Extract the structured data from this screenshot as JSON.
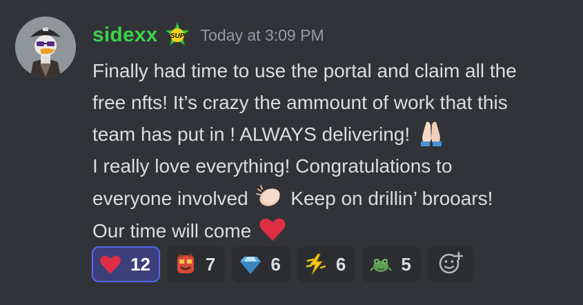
{
  "message": {
    "username": "sidexx",
    "badge_icon": "sup-badge-icon",
    "timestamp": "Today at 3:09 PM",
    "lines": [
      "Finally had time to use the portal and claim all the",
      "free nfts! It’s crazy the ammount of work that this",
      "team has put in ! ALWAYS delivering!",
      "I really love everything! Congratulations to",
      "everyone involved",
      "Keep on drillin’ brooars!",
      "Our time will come"
    ],
    "inline_emoji": [
      "folded-hands-emoji",
      "clapping-hands-emoji",
      "red-heart-emoji"
    ]
  },
  "reactions": [
    {
      "emoji": "red-heart-emoji",
      "count": "12",
      "active": true
    },
    {
      "emoji": "custom-mask-emoji",
      "count": "7",
      "active": false
    },
    {
      "emoji": "gem-emoji",
      "count": "6",
      "active": false
    },
    {
      "emoji": "custom-lightning-emoji",
      "count": "6",
      "active": false
    },
    {
      "emoji": "custom-frog-emoji",
      "count": "5",
      "active": false
    }
  ],
  "add_reaction_icon": "add-reaction-icon",
  "colors": {
    "background": "#313338",
    "username": "#3bd24a",
    "timestamp": "#949ba4",
    "text": "#dbdee1",
    "reaction_bg": "#2b2d31",
    "reaction_active_bg": "#3b3f7a",
    "reaction_active_border": "#5865f2"
  }
}
